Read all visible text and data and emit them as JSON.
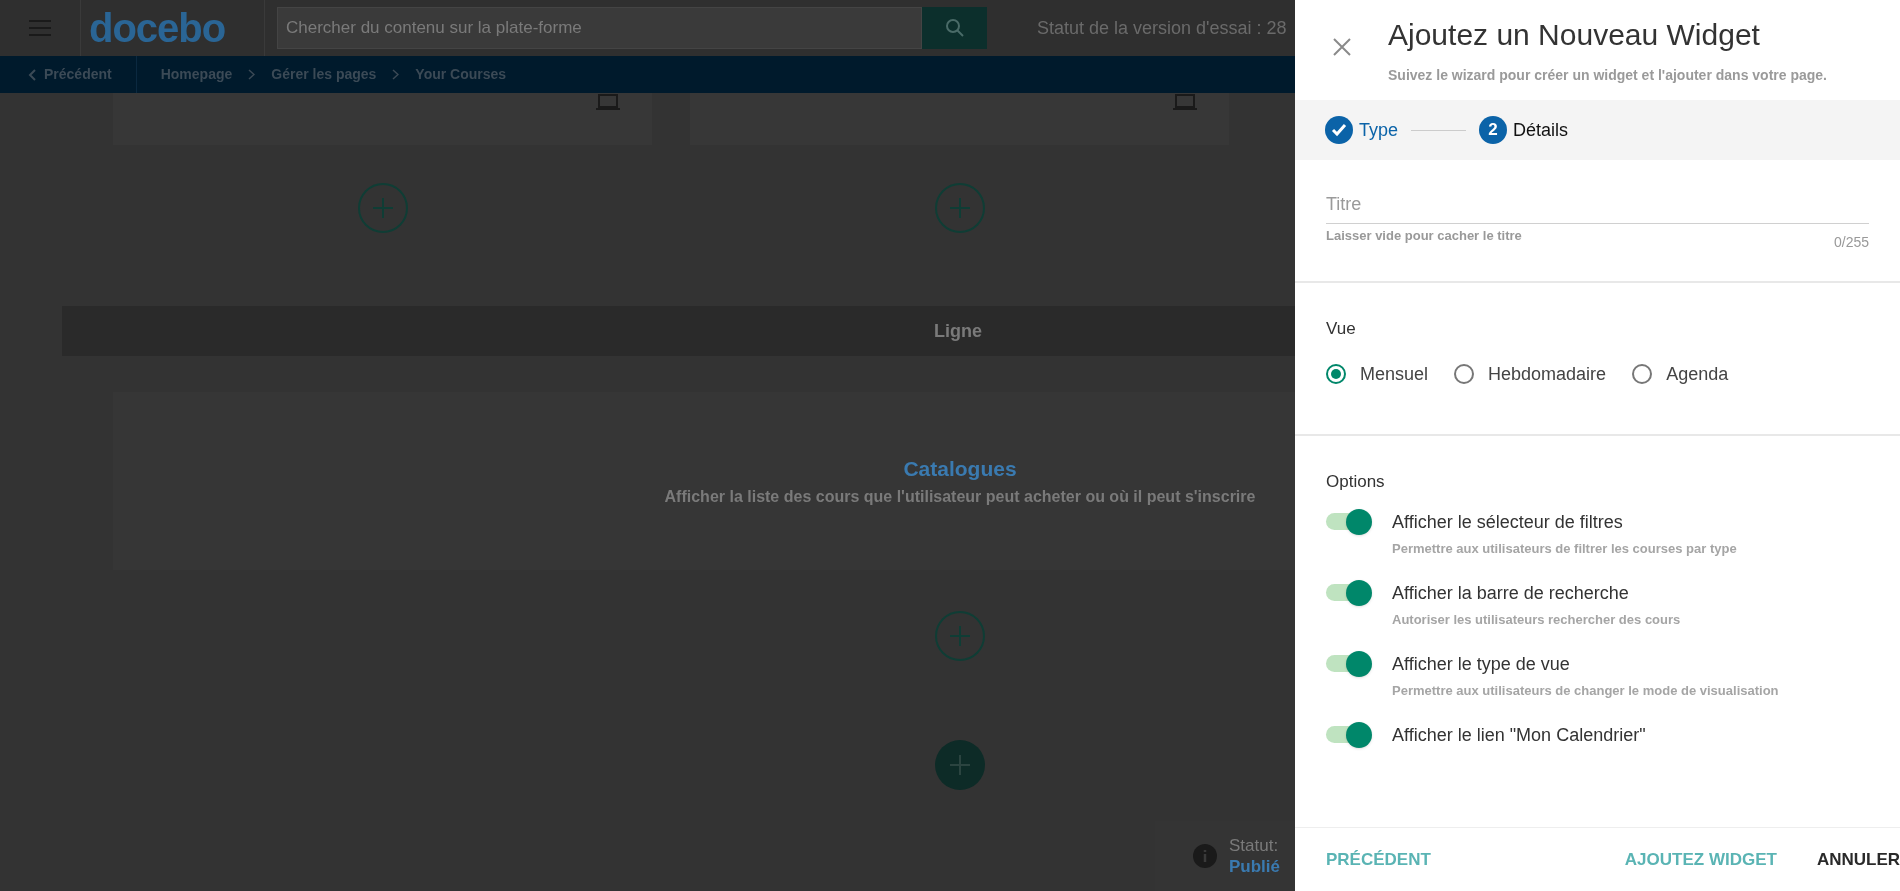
{
  "header": {
    "logo": "docebo",
    "search": {
      "placeholder": "Chercher du contenu sur la plate-forme"
    },
    "trial_status": "Statut de la version d'essai : 28"
  },
  "breadcrumb": {
    "back": "Précédent",
    "items": [
      "Homepage",
      "Gérer les pages",
      "Your Courses"
    ]
  },
  "page": {
    "row_label": "Ligne",
    "catalog": {
      "title": "Catalogues",
      "description": "Afficher la liste des cours que l'utilisateur peut acheter ou où il peut s'inscrire"
    },
    "status": {
      "label": "Statut:",
      "value": "Publié"
    }
  },
  "panel": {
    "title": "Ajoutez un Nouveau Widget",
    "subtitle": "Suivez le wizard pour créer un widget et l'ajouter dans votre page.",
    "steps": [
      {
        "label": "Type",
        "done": true,
        "selected": false
      },
      {
        "label": "Détails",
        "number": "2",
        "done": false,
        "selected": true
      }
    ],
    "title_field": {
      "placeholder": "Titre",
      "helper": "Laisser vide pour cacher le titre",
      "counter": "0/255"
    },
    "view": {
      "heading": "Vue",
      "options": [
        {
          "label": "Mensuel",
          "selected": true
        },
        {
          "label": "Hebdomadaire",
          "selected": false
        },
        {
          "label": "Agenda",
          "selected": false
        }
      ]
    },
    "options": {
      "heading": "Options",
      "items": [
        {
          "label": "Afficher le sélecteur de filtres",
          "description": "Permettre aux utilisateurs de filtrer les courses par type",
          "on": true
        },
        {
          "label": "Afficher la barre de recherche",
          "description": "Autoriser les utilisateurs rechercher des cours",
          "on": true
        },
        {
          "label": "Afficher le type de vue",
          "description": "Permettre aux utilisateurs de changer le mode de visualisation",
          "on": true
        },
        {
          "label": "Afficher le lien \"Mon Calendrier\"",
          "on": true
        }
      ]
    },
    "buttons": {
      "back": "PRÉCÉDENT",
      "add": "AJOUTEZ WIDGET",
      "cancel": "ANNULER"
    }
  }
}
